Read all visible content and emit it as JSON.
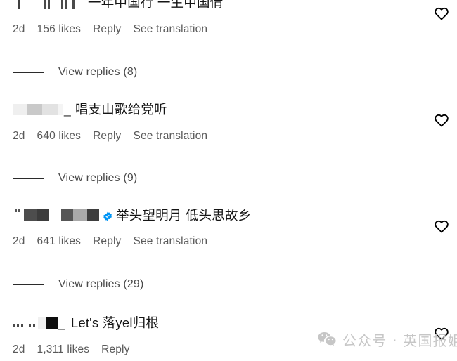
{
  "app": {
    "screen": "instagram-comments",
    "background": "#ffffff"
  },
  "colors": {
    "text_primary": "#151515",
    "text_meta": "#5a5a5a",
    "verified_blue": "#0095f6",
    "divider": "#2b2b2b",
    "watermark": "#c6c6c6"
  },
  "labels": {
    "reply": "Reply",
    "see_translation": "See translation",
    "likes_suffix": "likes",
    "like_icon": "heart-icon",
    "verified_icon": "verified-badge-icon"
  },
  "comments": [
    {
      "id": "comment-1",
      "username_redacted": true,
      "username_style": "clipped",
      "verified": false,
      "text": "一年中国行 一生中国情",
      "time": "2d",
      "likes": "156 likes",
      "reply": "Reply",
      "translate": "See translation",
      "replies_label": "View replies (8)",
      "has_replies": true
    },
    {
      "id": "comment-2",
      "username_redacted": true,
      "username_style": "light-blur",
      "verified": false,
      "text": "唱支山歌给党听",
      "time": "2d",
      "likes": "640 likes",
      "reply": "Reply",
      "translate": "See translation",
      "replies_label": "View replies (9)",
      "has_replies": true
    },
    {
      "id": "comment-3",
      "username_redacted": true,
      "username_style": "dark-blocks",
      "verified": true,
      "text": "举头望明月 低头思故乡",
      "time": "2d",
      "likes": "641 likes",
      "reply": "Reply",
      "translate": "See translation",
      "replies_label": "View replies (29)",
      "has_replies": true
    },
    {
      "id": "comment-4",
      "username_redacted": true,
      "username_style": "black-square",
      "verified": false,
      "text": "Let's 落yel归根",
      "time": "2d",
      "likes": "1,311 likes",
      "reply": "Reply",
      "translate": "",
      "replies_label": "",
      "has_replies": false
    }
  ],
  "watermark": {
    "icon": "wechat-icon",
    "text": "公众号 · 英国报姐"
  }
}
